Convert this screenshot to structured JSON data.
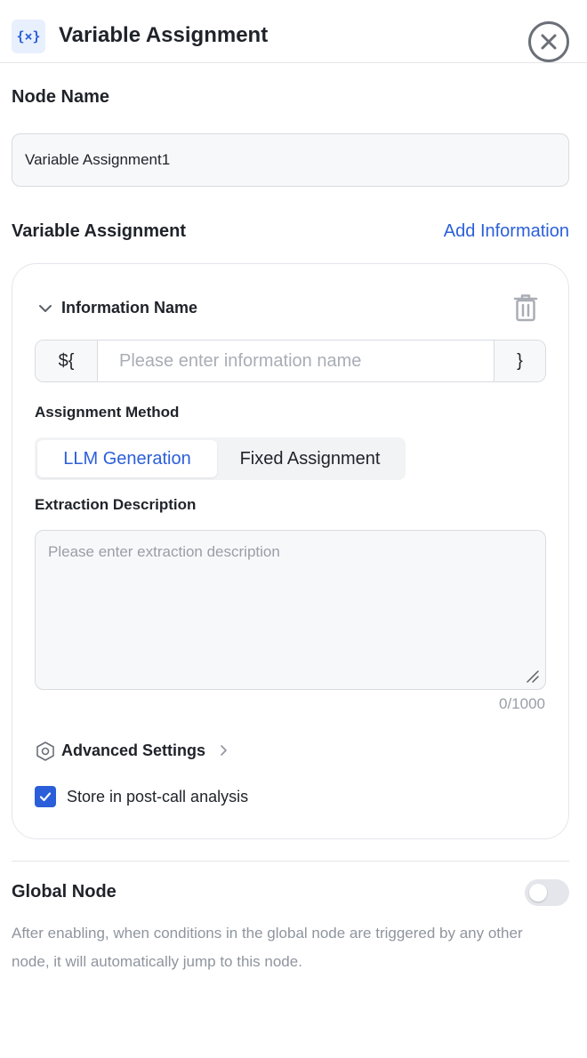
{
  "header": {
    "icon_text": "{×}",
    "title": "Variable Assignment"
  },
  "node_name": {
    "label": "Node Name",
    "value": "Variable Assignment1"
  },
  "variable_assignment": {
    "label": "Variable Assignment",
    "add_label": "Add Information",
    "card": {
      "info_name_label": "Information Name",
      "prefix": "${",
      "suffix": "}",
      "info_placeholder": "Please enter information name",
      "method_label": "Assignment Method",
      "methods": [
        "LLM Generation",
        "Fixed Assignment"
      ],
      "selected_method": "LLM Generation",
      "extraction_label": "Extraction Description",
      "extraction_placeholder": "Please enter extraction description",
      "char_count": "0/1000",
      "advanced_label": "Advanced Settings",
      "store_label": "Store in post-call analysis",
      "store_checked": true
    }
  },
  "global_node": {
    "label": "Global Node",
    "enabled": false,
    "description": "After enabling, when conditions in the global node are triggered by any other node, it will automatically jump to this node."
  },
  "colors": {
    "accent": "#2b5fd9",
    "border": "#d9dbe0",
    "muted_text": "#8f959e"
  }
}
